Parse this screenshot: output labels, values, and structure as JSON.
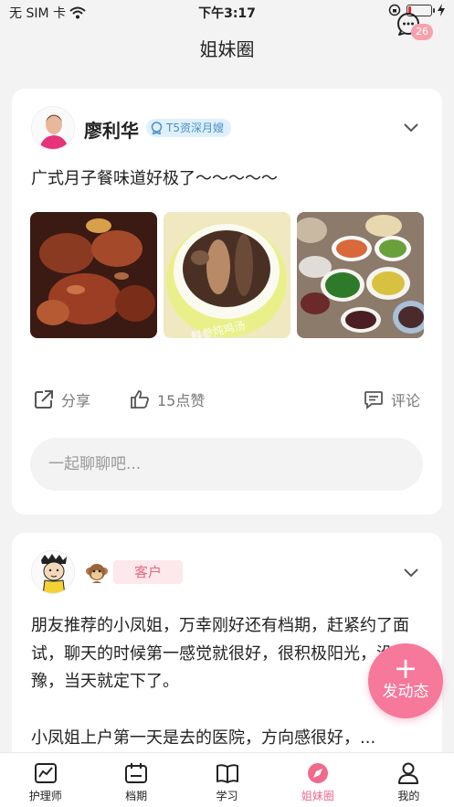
{
  "status_bar": {
    "carrier": "无 SIM 卡",
    "time": "下午3:17"
  },
  "header": {
    "title": "姐妹圈",
    "message_badge": "26"
  },
  "posts": [
    {
      "author": "廖利华",
      "badge": "T5资深月嫂",
      "text": "广式月子餐味道好极了～～～～～",
      "image_caption": "鲜参炖鸡汤",
      "actions": {
        "share": "分享",
        "like": "15点赞",
        "comment": "评论"
      },
      "comment_placeholder": "一起聊聊吧..."
    },
    {
      "tag": "客户",
      "paragraph1": "朋友推荐的小凤姐，万幸刚好还有档期，赶紧约了面试，聊天的时候第一感觉就很好，很积极阳光，没犹豫，当天就定下了。",
      "paragraph2": "小凤姐上户第一天是去的医院，方向感很好，..."
    }
  ],
  "fab": {
    "label": "发动态"
  },
  "tabs": [
    {
      "label": "护理师",
      "icon": "chart-icon"
    },
    {
      "label": "档期",
      "icon": "calendar-icon"
    },
    {
      "label": "学习",
      "icon": "book-icon"
    },
    {
      "label": "姐妹圈",
      "icon": "compass-icon",
      "active": true
    },
    {
      "label": "我的",
      "icon": "person-icon"
    }
  ],
  "colors": {
    "accent": "#f06a8c",
    "fab": "#f6789a",
    "badge_blue": "#4a90c9",
    "tag_pink": "#e5667d"
  }
}
